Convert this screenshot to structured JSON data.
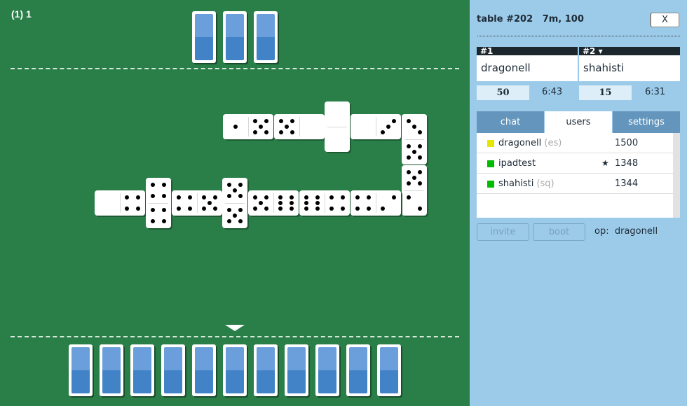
{
  "board": {
    "score_label": "(1) 1",
    "opponent_hand_count": 3,
    "player_hand_count": 11,
    "tiles": [
      {
        "a": 1,
        "b": 5,
        "orient": "h"
      },
      {
        "a": 5,
        "b": 0,
        "orient": "h"
      },
      {
        "a": 0,
        "b": 0,
        "orient": "v"
      },
      {
        "a": 0,
        "b": 3,
        "orient": "h"
      },
      {
        "a": 3,
        "b": 5,
        "orient": "v"
      },
      {
        "a": 5,
        "b": 2,
        "orient": "v"
      },
      {
        "a": 0,
        "b": 4,
        "orient": "h"
      },
      {
        "a": 4,
        "b": 4,
        "orient": "v"
      },
      {
        "a": 4,
        "b": 5,
        "orient": "h"
      },
      {
        "a": 5,
        "b": 5,
        "orient": "v"
      },
      {
        "a": 5,
        "b": 6,
        "orient": "h"
      },
      {
        "a": 6,
        "b": 4,
        "orient": "h"
      },
      {
        "a": 4,
        "b": 2,
        "orient": "h"
      }
    ],
    "colors": {
      "felt": "#2a7f48",
      "tile_back_top": "#6a9fdc",
      "tile_back_bottom": "#4283c8"
    }
  },
  "panel": {
    "title": "table #202   7m, 100",
    "minimize_label": "–",
    "close_label": "X",
    "players": [
      {
        "seat": "#1",
        "name": "dragonell",
        "points": "50",
        "clock": "6:43"
      },
      {
        "seat": "#2 ▾",
        "name": "shahisti",
        "points": "15",
        "clock": "6:31"
      }
    ],
    "tabs": [
      {
        "label": "chat",
        "active": false
      },
      {
        "label": "users",
        "active": true
      },
      {
        "label": "settings",
        "active": false
      }
    ],
    "users": [
      {
        "name": "dragonell",
        "lang": "(es)",
        "star": "",
        "rating": "1500",
        "status_color": "#e6e600"
      },
      {
        "name": "ipadtest",
        "lang": "",
        "star": "★",
        "rating": "1348",
        "status_color": "#00bb00"
      },
      {
        "name": "shahisti",
        "lang": "(sq)",
        "star": "",
        "rating": "1344",
        "status_color": "#00bb00"
      }
    ],
    "invite_label": "invite",
    "boot_label": "boot",
    "op_label": "op:  dragonell"
  }
}
